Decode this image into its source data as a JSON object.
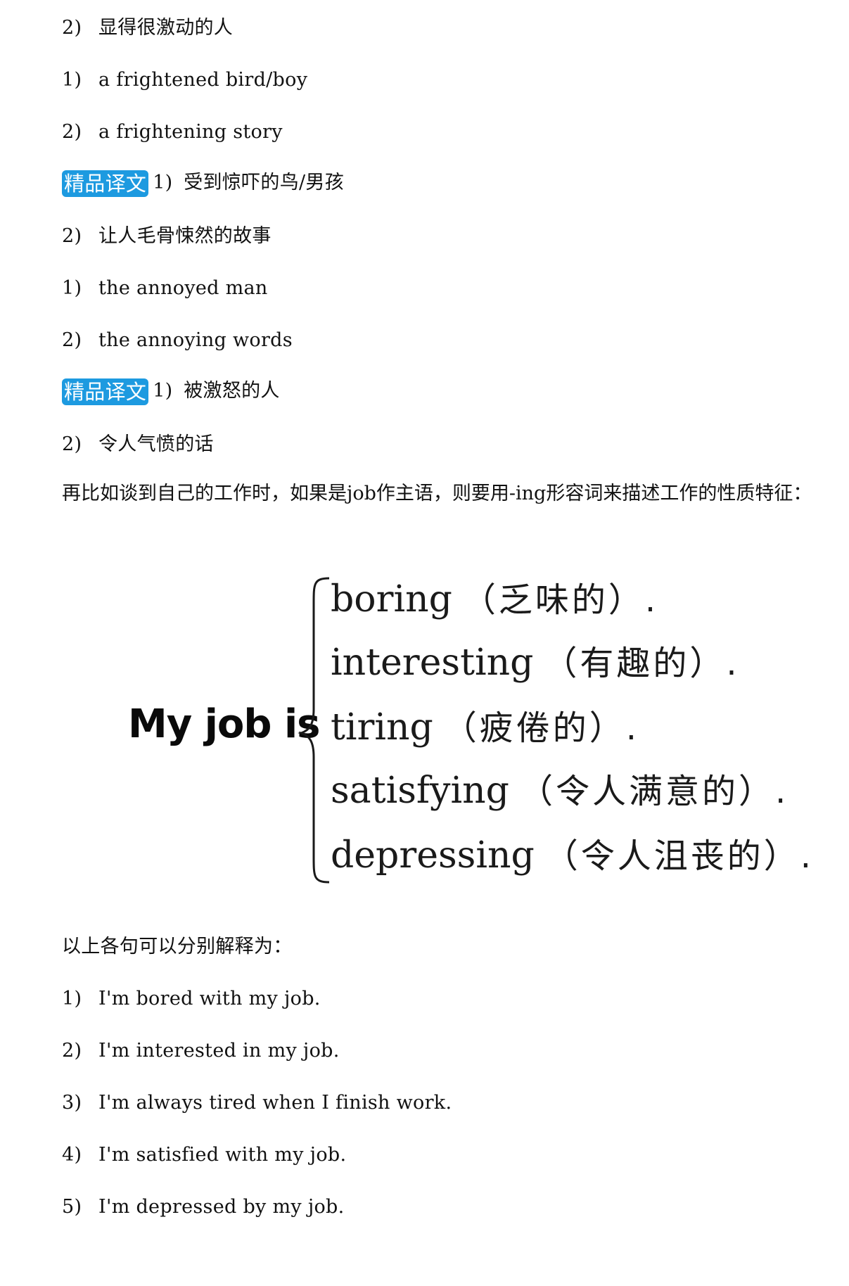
{
  "lines_top": [
    {
      "num": "2)",
      "text": "显得很激动的人"
    },
    {
      "num": "1)",
      "text": "a frightened bird/boy"
    },
    {
      "num": "2)",
      "text": "a frightening story"
    }
  ],
  "section1": {
    "badge": "精品译文",
    "num": "1)",
    "text": "受到惊吓的鸟/男孩",
    "next": {
      "num": "2)",
      "text": "让人毛骨悚然的故事"
    }
  },
  "lines_mid": [
    {
      "num": "1)",
      "text": "the annoyed man"
    },
    {
      "num": "2)",
      "text": "the annoying words"
    }
  ],
  "section2": {
    "badge": "精品译文",
    "num": "1)",
    "text": "被激怒的人",
    "next": {
      "num": "2)",
      "text": "令人气愤的话"
    }
  },
  "paragraph": "再比如谈到自己的工作时，如果是job作主语，则要用-ing形容词来描述工作的性质特征：",
  "figure": {
    "subject": "My job is",
    "items": [
      {
        "word": "boring",
        "gloss": "（乏味的）."
      },
      {
        "word": "interesting",
        "gloss": "（有趣的）."
      },
      {
        "word": "tiring",
        "gloss": "（疲倦的）."
      },
      {
        "word": "satisfying",
        "gloss": "（令人满意的）."
      },
      {
        "word": "depressing",
        "gloss": "（令人沮丧的）."
      }
    ]
  },
  "explain_intro": "以上各句可以分别解释为：",
  "explanations": [
    {
      "num": "1)",
      "text": "I'm bored with my job."
    },
    {
      "num": "2)",
      "text": "I'm interested in my job."
    },
    {
      "num": "3)",
      "text": "I'm always tired when I finish work."
    },
    {
      "num": "4)",
      "text": "I'm satisfied with my job."
    },
    {
      "num": "5)",
      "text": "I'm depressed by my job."
    }
  ],
  "colors": {
    "badge": "#1d9ae0"
  }
}
